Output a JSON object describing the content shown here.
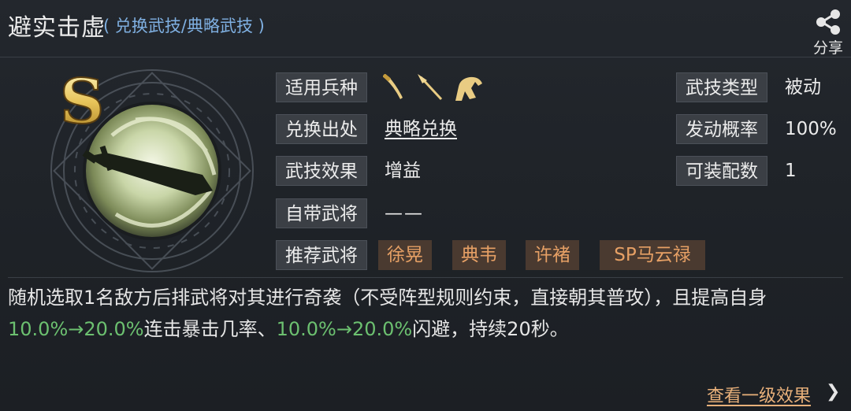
{
  "header": {
    "title": "避实击虚",
    "subtitle": "( 兑换武技/典略武技 )",
    "share_label": "分享"
  },
  "skill": {
    "grade": "S",
    "troop_icons": [
      "saber-icon",
      "spear-icon",
      "horse-icon"
    ],
    "labels": {
      "troop_type": "适用兵种",
      "source": "兑换出处",
      "effect": "武技效果",
      "own_general": "自带武将",
      "recommended": "推荐武将",
      "skill_type": "武技类型",
      "trigger_rate": "发动概率",
      "equip_count": "可装配数"
    },
    "values": {
      "source": "典略兑换",
      "effect": "增益",
      "own_general": "——",
      "skill_type": "被动",
      "trigger_rate": "100%",
      "equip_count": "1"
    },
    "recommended_generals": [
      "徐晃",
      "典韦",
      "许褚",
      "SP马云禄"
    ]
  },
  "description": {
    "part1": "随机选取1名敌方后排武将对其进行奇袭（不受阵型规则约束，直接朝其普攻），且提高自身",
    "value1": "10.0%→20.0%",
    "part2": "连击暴击几率、",
    "value2": "10.0%→20.0%",
    "part3": "闪避，持续20秒。"
  },
  "footer": {
    "more_label": "查看一级效果",
    "arrow": "❯"
  },
  "colors": {
    "accent_blue": "#7fb0e2",
    "highlight_green": "#6cc070",
    "general_tag_text": "#e6a065",
    "link_orange": "#e8b07a"
  }
}
